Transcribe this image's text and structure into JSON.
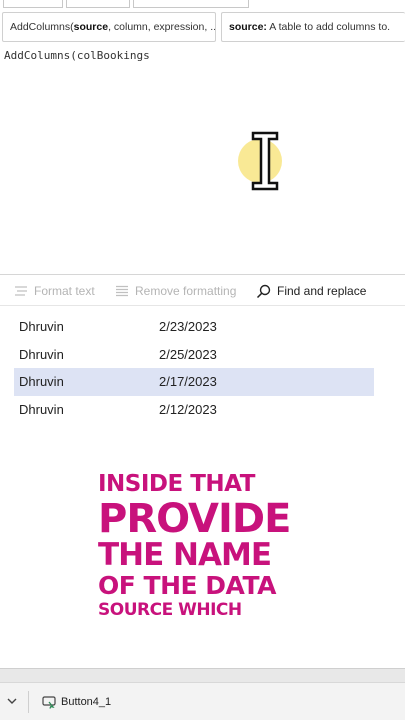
{
  "formula_hint": {
    "signature_prefix": "AddColumns(",
    "signature_current_param": "source",
    "signature_rest": ", column, expression, ...)",
    "param_name": "source:",
    "param_description": " A table to add columns to."
  },
  "editor": {
    "code": "AddColumns(colBookings"
  },
  "toolbar": {
    "format_text_label": "Format text",
    "remove_formatting_label": "Remove formatting",
    "find_replace_label": "Find and replace"
  },
  "data_rows": [
    {
      "name": "Dhruvin",
      "date": "2/23/2023",
      "selected": false
    },
    {
      "name": "Dhruvin",
      "date": "2/25/2023",
      "selected": false
    },
    {
      "name": "Dhruvin",
      "date": "2/17/2023",
      "selected": true
    },
    {
      "name": "Dhruvin",
      "date": "2/12/2023",
      "selected": false
    }
  ],
  "caption": {
    "line1": "INSIDE THAT",
    "line2": "PROVIDE",
    "line3": "THE NAME",
    "line4": "OF THE DATA",
    "line5": "SOURCE WHICH"
  },
  "status_bar": {
    "control_name": "Button4_1"
  },
  "colors": {
    "caption": "#c8127c",
    "selected_row": "#dde3f4",
    "cursor_highlight": "#f8e78a"
  },
  "icons": {
    "format_text": "format-text-icon",
    "remove_formatting": "remove-formatting-icon",
    "find_replace": "search-icon",
    "status_control": "button-control-icon",
    "status_expand": "chevron-down-icon"
  }
}
